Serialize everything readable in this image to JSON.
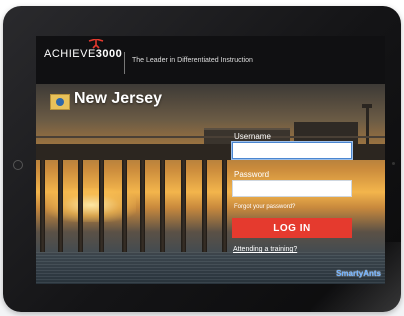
{
  "header": {
    "logo": {
      "main": "ACHIEVE",
      "strong": "3000"
    },
    "tagline": "The Leader in Differentiated Instruction"
  },
  "hero": {
    "state_name": "New Jersey"
  },
  "login": {
    "username_label": "Username",
    "username_value": "",
    "password_label": "Password",
    "password_value": "",
    "forgot_password_link": "Forgot your password?",
    "submit_label": "LOG IN",
    "training_link": "Attending a training?"
  },
  "badge": {
    "text": "SmartyAnts"
  },
  "colors": {
    "accent_red": "#e53a2e",
    "header_bg": "#101012",
    "focus_blue": "#4b86d0"
  },
  "icons": [
    "achieve3000-logo-icon",
    "new-jersey-flag-icon",
    "smartyants-logo-icon"
  ]
}
